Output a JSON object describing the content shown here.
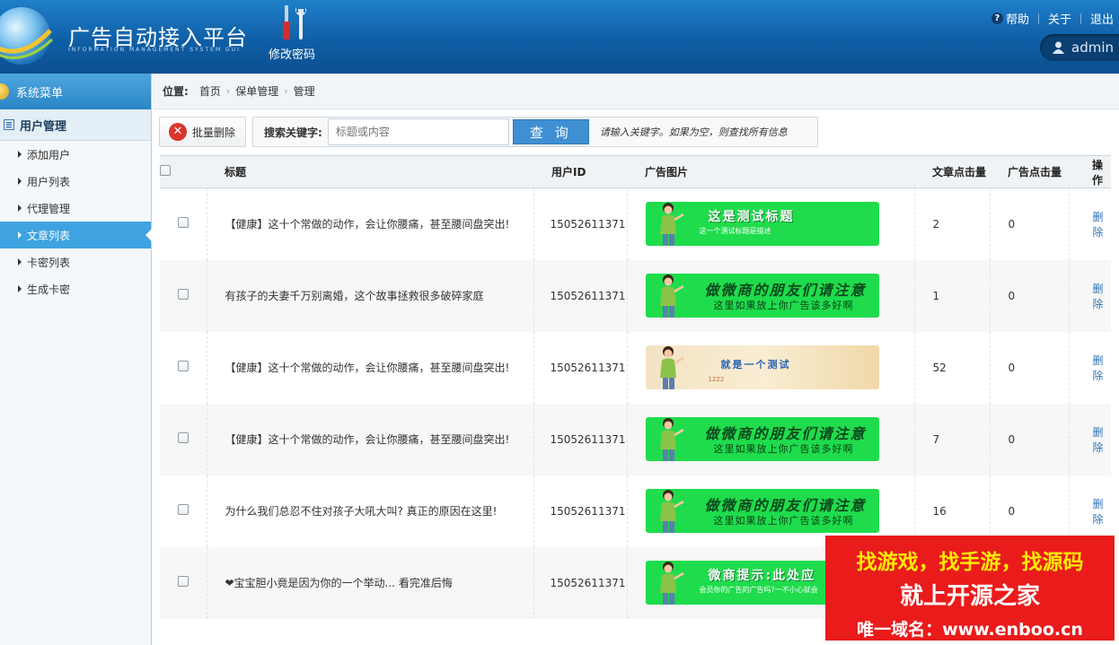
{
  "header": {
    "title": "广告自动接入平台",
    "subtitle": "INFORMATION MANAGEMENT SYSTEM GUI",
    "tool_label": "修改密码",
    "links": [
      "帮助",
      "关于",
      "退出"
    ],
    "user": "admin"
  },
  "sidebar": {
    "heading": "系统菜单",
    "group": "用户管理",
    "items": [
      {
        "label": "添加用户"
      },
      {
        "label": "用户列表"
      },
      {
        "label": "代理管理"
      },
      {
        "label": "文章列表",
        "active": true
      },
      {
        "label": "卡密列表"
      },
      {
        "label": "生成卡密"
      }
    ]
  },
  "breadcrumb": {
    "label": "位置:",
    "items": [
      "首页",
      "保单管理",
      "管理"
    ]
  },
  "toolbar": {
    "delete_label": "批量删除",
    "search_label": "搜索关键字:",
    "search_placeholder": "标题或内容",
    "query_label": "查 询",
    "hint": "请输入关键字。如果为空，则查找所有信息"
  },
  "table": {
    "headers": [
      "标题",
      "用户ID",
      "广告图片",
      "文章点击量",
      "广告点击量",
      "操作"
    ],
    "rows": [
      {
        "title": "【健康】这十个常做的动作，会让你腰痛，甚至腰间盘突出!",
        "uid": "15052611371",
        "views": "2",
        "ad_clicks": "0",
        "op": "删除",
        "banner": {
          "style": "green",
          "line1": "这是测试标题",
          "line2": "这一个测试标题是描述"
        }
      },
      {
        "title": "有孩子的夫妻千万别离婚，这个故事拯救很多破碎家庭",
        "uid": "15052611371",
        "views": "1",
        "ad_clicks": "0",
        "op": "删除",
        "banner": {
          "style": "green-dark",
          "line1": "做微商的朋友们请注意",
          "line2": "这里如果放上你广告该多好啊"
        }
      },
      {
        "title": "【健康】这十个常做的动作，会让你腰痛，甚至腰间盘突出!",
        "uid": "15052611371",
        "views": "52",
        "ad_clicks": "0",
        "op": "删除",
        "banner": {
          "style": "cream",
          "line1": "就是一个测试",
          "line2": "1222"
        }
      },
      {
        "title": "【健康】这十个常做的动作，会让你腰痛，甚至腰间盘突出!",
        "uid": "15052611371",
        "views": "7",
        "ad_clicks": "0",
        "op": "删除",
        "banner": {
          "style": "green-dark",
          "line1": "做微商的朋友们请注意",
          "line2": "这里如果放上你广告该多好啊"
        }
      },
      {
        "title": "为什么我们总忍不住对孩子大吼大叫? 真正的原因在这里!",
        "uid": "15052611371",
        "views": "16",
        "ad_clicks": "0",
        "op": "删除",
        "banner": {
          "style": "green-dark",
          "line1": "做微商的朋友们请注意",
          "line2": "这里如果放上你广告该多好啊"
        }
      },
      {
        "title": "❤宝宝胆小竟是因为你的一个举动... 看完准后悔",
        "uid": "15052611371",
        "views": "",
        "ad_clicks": "",
        "op": "",
        "banner": {
          "style": "green",
          "line1": "微商提示:此处应",
          "line2": "会员你的广告的广告吗?一不小心就会"
        }
      }
    ]
  },
  "watermark": {
    "line1": "找游戏，找手游，找源码",
    "line2": "就上开源之家",
    "line3": "唯一域名：www.enboo.cn"
  }
}
